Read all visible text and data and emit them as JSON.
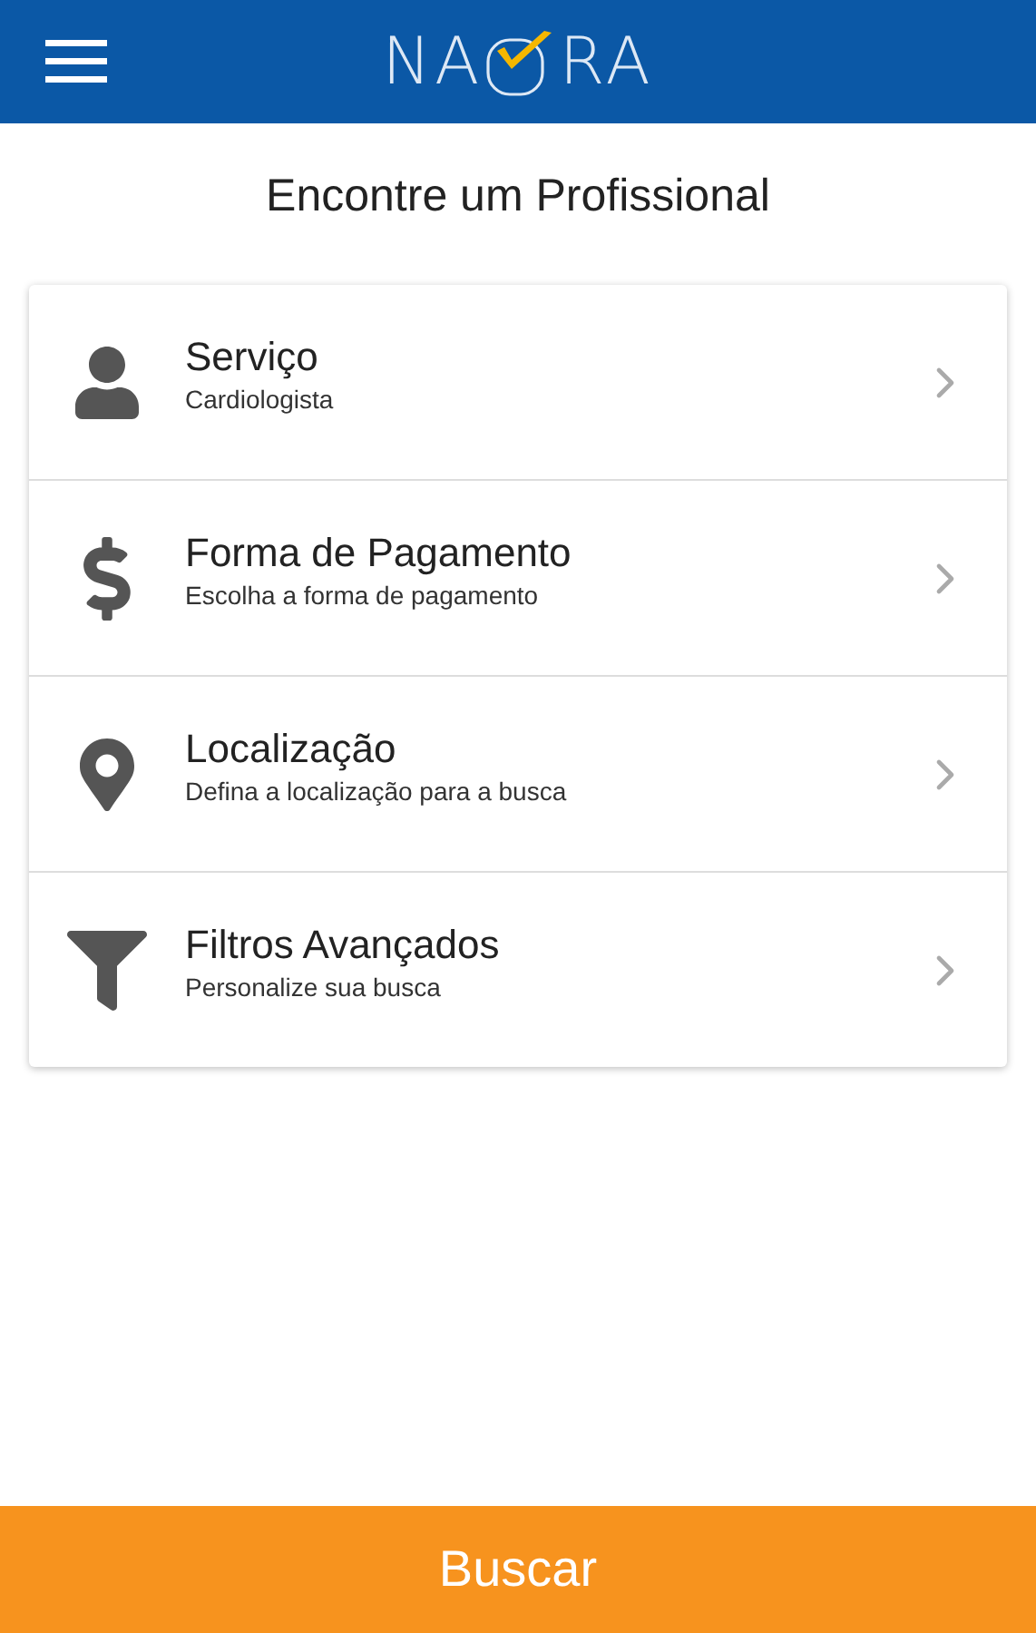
{
  "header": {
    "logo": {
      "left": "NA",
      "right": "RA"
    }
  },
  "title": "Encontre um Profissional",
  "options": [
    {
      "label": "Serviço",
      "value": "Cardiologista"
    },
    {
      "label": "Forma de Pagamento",
      "value": "Escolha a forma de pagamento"
    },
    {
      "label": "Localização",
      "value": "Defina a localização para a busca"
    },
    {
      "label": "Filtros Avançados",
      "value": "Personalize sua busca"
    }
  ],
  "search_button": "Buscar"
}
